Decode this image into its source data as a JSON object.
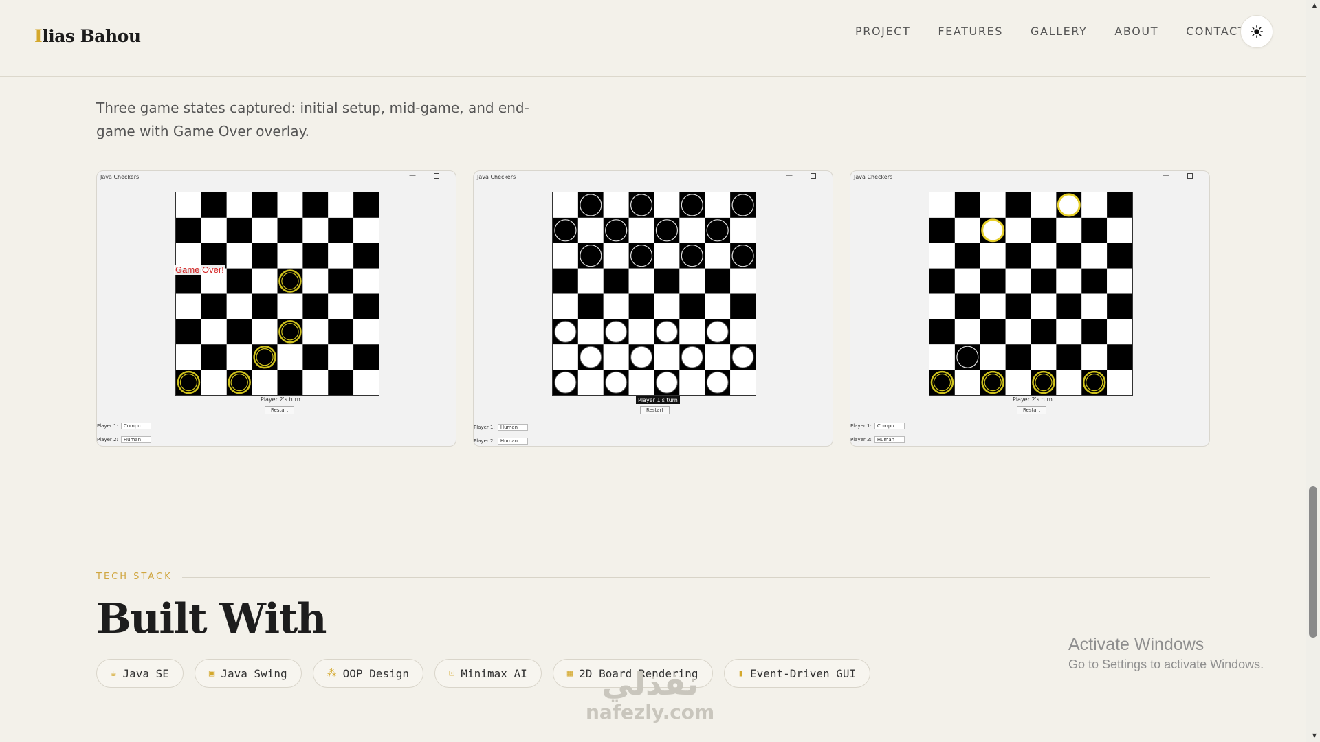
{
  "header": {
    "logo_initial": "I",
    "logo_rest": "lias Bahou",
    "nav": [
      "PROJECT",
      "FEATURES",
      "GALLERY",
      "ABOUT",
      "CONTACT"
    ],
    "theme_icon": "sun-icon"
  },
  "gallery": {
    "description": "Three game states captured: initial setup, mid-game, and end-game with Game Over overlay.",
    "screens": [
      {
        "window_title": "Java Checkers",
        "turn_text": "Player 2's turn",
        "restart_label": "Restart",
        "overlay_text": "Game Over!",
        "player1_label": "Player 1:",
        "player1_value": "Compu...",
        "player2_label": "Player 2:",
        "player2_value": "Human",
        "pieces": [
          {
            "row": 3,
            "col": 4,
            "color": "yellow"
          },
          {
            "row": 5,
            "col": 4,
            "color": "yellow"
          },
          {
            "row": 6,
            "col": 3,
            "color": "yellow"
          },
          {
            "row": 7,
            "col": 0,
            "color": "yellow"
          },
          {
            "row": 7,
            "col": 2,
            "color": "yellow"
          }
        ]
      },
      {
        "window_title": "Java Checkers",
        "turn_text": "Player 1's turn",
        "restart_label": "Restart",
        "overlay_text": "",
        "player1_label": "Player 1:",
        "player1_value": "Human",
        "player2_label": "Player 2:",
        "player2_value": "Human",
        "pieces": [
          {
            "row": 0,
            "col": 1,
            "color": "black"
          },
          {
            "row": 0,
            "col": 3,
            "color": "black"
          },
          {
            "row": 0,
            "col": 5,
            "color": "black"
          },
          {
            "row": 0,
            "col": 7,
            "color": "black"
          },
          {
            "row": 1,
            "col": 0,
            "color": "black"
          },
          {
            "row": 1,
            "col": 2,
            "color": "black"
          },
          {
            "row": 1,
            "col": 4,
            "color": "black"
          },
          {
            "row": 1,
            "col": 6,
            "color": "black"
          },
          {
            "row": 2,
            "col": 1,
            "color": "black"
          },
          {
            "row": 2,
            "col": 3,
            "color": "black"
          },
          {
            "row": 2,
            "col": 5,
            "color": "black"
          },
          {
            "row": 2,
            "col": 7,
            "color": "black"
          },
          {
            "row": 5,
            "col": 0,
            "color": "white"
          },
          {
            "row": 5,
            "col": 2,
            "color": "white"
          },
          {
            "row": 5,
            "col": 4,
            "color": "white"
          },
          {
            "row": 5,
            "col": 6,
            "color": "white"
          },
          {
            "row": 6,
            "col": 1,
            "color": "white"
          },
          {
            "row": 6,
            "col": 3,
            "color": "white"
          },
          {
            "row": 6,
            "col": 5,
            "color": "white"
          },
          {
            "row": 6,
            "col": 7,
            "color": "white"
          },
          {
            "row": 7,
            "col": 0,
            "color": "white"
          },
          {
            "row": 7,
            "col": 2,
            "color": "white"
          },
          {
            "row": 7,
            "col": 4,
            "color": "white"
          },
          {
            "row": 7,
            "col": 6,
            "color": "white"
          }
        ]
      },
      {
        "window_title": "Java Checkers",
        "turn_text": "Player 2's turn",
        "restart_label": "Restart",
        "overlay_text": "",
        "player1_label": "Player 1:",
        "player1_value": "Compu...",
        "player2_label": "Player 2:",
        "player2_value": "Human",
        "pieces": [
          {
            "row": 0,
            "col": 5,
            "color": "whiteking"
          },
          {
            "row": 1,
            "col": 2,
            "color": "whiteking"
          },
          {
            "row": 6,
            "col": 1,
            "color": "black"
          },
          {
            "row": 7,
            "col": 0,
            "color": "yellow"
          },
          {
            "row": 7,
            "col": 2,
            "color": "yellow"
          },
          {
            "row": 7,
            "col": 4,
            "color": "yellow"
          },
          {
            "row": 7,
            "col": 6,
            "color": "yellow"
          }
        ]
      }
    ]
  },
  "tech": {
    "tag": "TECH STACK",
    "title": "Built With",
    "chips": [
      {
        "label": "Java SE",
        "icon": "coffee-icon"
      },
      {
        "label": "Java Swing",
        "icon": "window-icon"
      },
      {
        "label": "OOP Design",
        "icon": "hierarchy-icon"
      },
      {
        "label": "Minimax AI",
        "icon": "robot-icon"
      },
      {
        "label": "2D Board Rendering",
        "icon": "grid-icon"
      },
      {
        "label": "Event-Driven GUI",
        "icon": "mouse-icon"
      }
    ]
  },
  "overlays": {
    "activate_title": "Activate Windows",
    "activate_sub": "Go to Settings to activate Windows.",
    "watermark_ar": "نفذلي",
    "watermark_en": "nafezly.com"
  },
  "colors": {
    "accent": "#d4a82c",
    "background": "#f3f1ea",
    "game_over": "#d31f1f"
  }
}
